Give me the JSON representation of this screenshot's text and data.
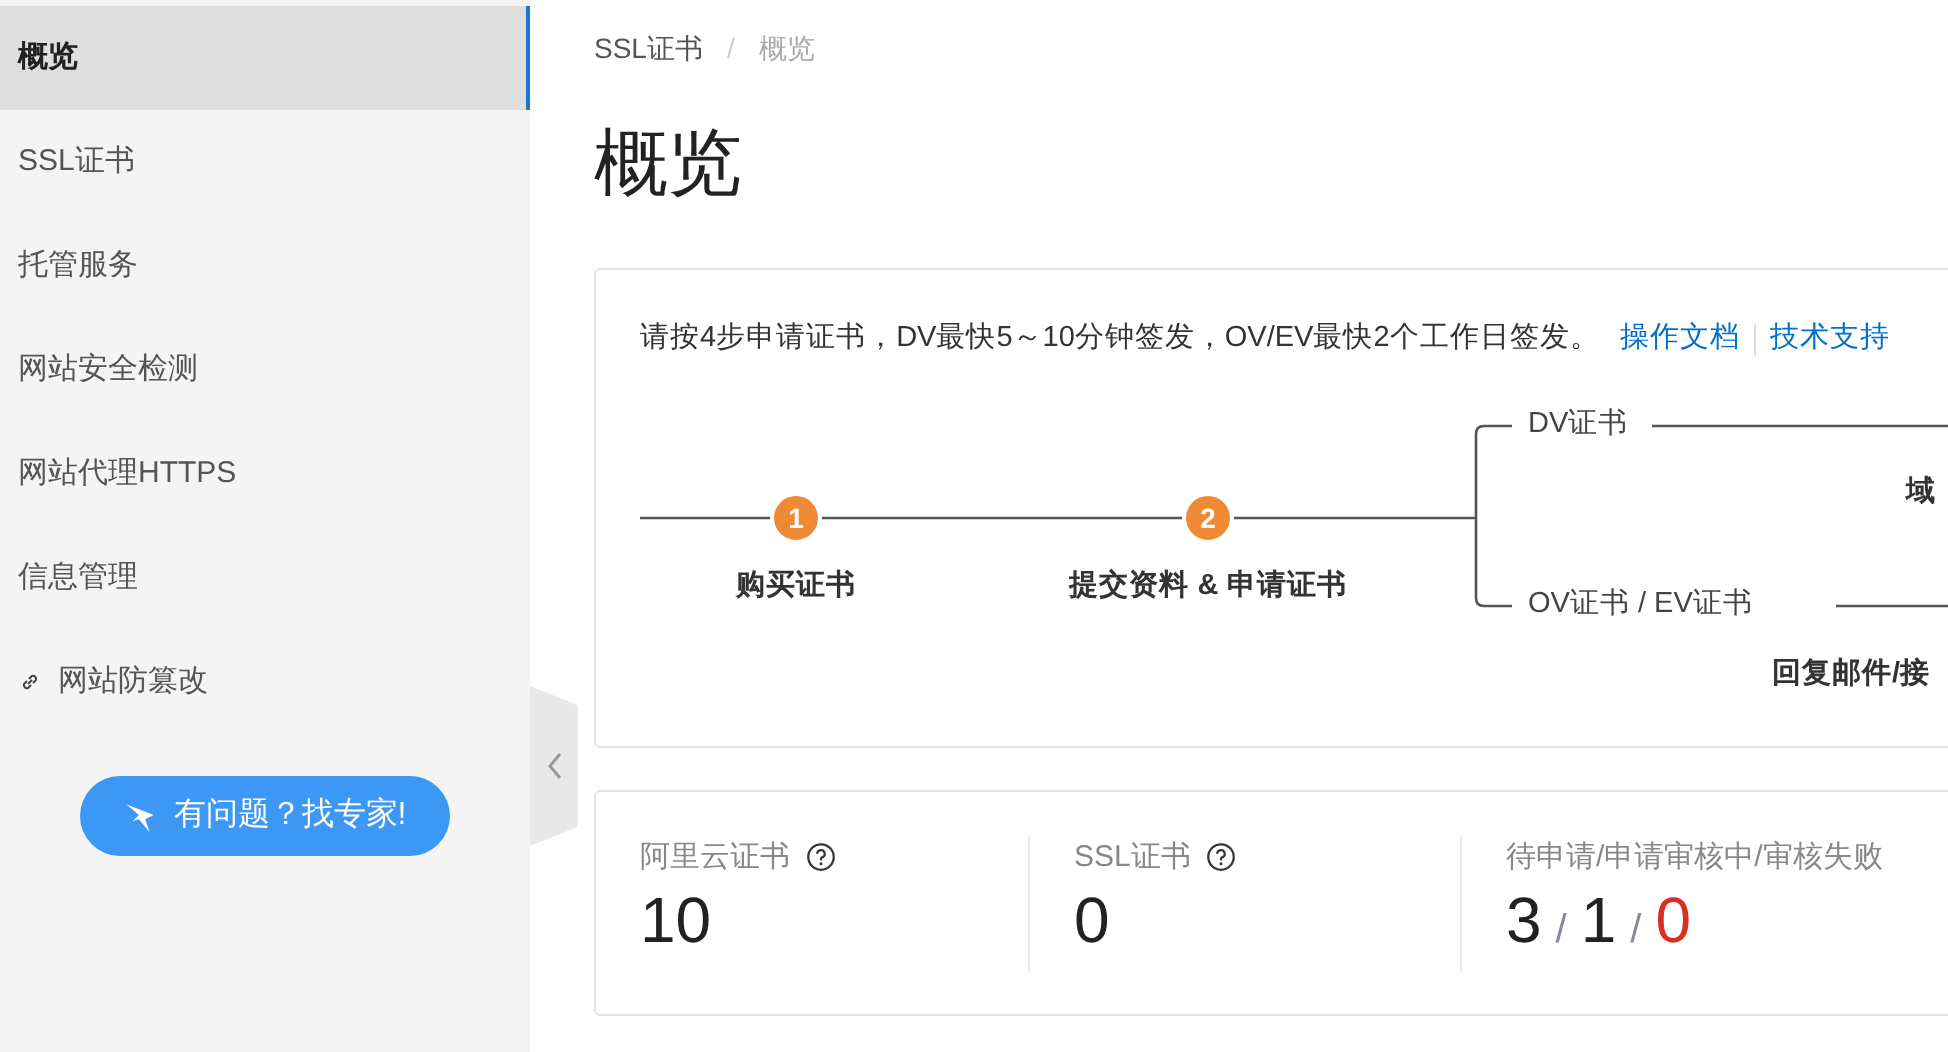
{
  "sidebar": {
    "items": [
      {
        "label": "概览",
        "selected": true,
        "kind": "plain"
      },
      {
        "label": "SSL证书",
        "selected": false,
        "kind": "plain"
      },
      {
        "label": "托管服务",
        "selected": false,
        "kind": "plain"
      },
      {
        "label": "网站安全检测",
        "selected": false,
        "kind": "plain"
      },
      {
        "label": "网站代理HTTPS",
        "selected": false,
        "kind": "plain"
      },
      {
        "label": "信息管理",
        "selected": false,
        "kind": "plain"
      },
      {
        "label": "网站防篡改",
        "selected": false,
        "kind": "link"
      }
    ],
    "expert_button": "有问题？找专家!"
  },
  "breadcrumb": [
    "SSL证书",
    "概览"
  ],
  "breadcrumb_separator": "/",
  "title": "概览",
  "guide": {
    "text": "请按4步申请证书，DV最快5～10分钟签发，OV/EV最快2个工作日签发。",
    "links": [
      "操作文档",
      "技术支持"
    ],
    "steps": [
      {
        "number": "1",
        "label": "购买证书"
      },
      {
        "number": "2",
        "label": "提交资料 & 申请证书"
      }
    ],
    "branches": [
      {
        "label": "DV证书",
        "step_label": "域"
      },
      {
        "label": "OV证书 / EV证书",
        "step_label": "回复邮件/接"
      }
    ]
  },
  "stats": [
    {
      "label": "阿里云证书",
      "help": true,
      "values": [
        {
          "text": "10",
          "alert": false
        }
      ]
    },
    {
      "label": "SSL证书",
      "help": true,
      "values": [
        {
          "text": "0",
          "alert": false
        }
      ]
    },
    {
      "label": "待申请/申请审核中/审核失败",
      "help": false,
      "values": [
        {
          "text": "3",
          "alert": false
        },
        {
          "text": "1",
          "alert": false
        },
        {
          "text": "0",
          "alert": true
        }
      ]
    }
  ],
  "value_separator": "/"
}
